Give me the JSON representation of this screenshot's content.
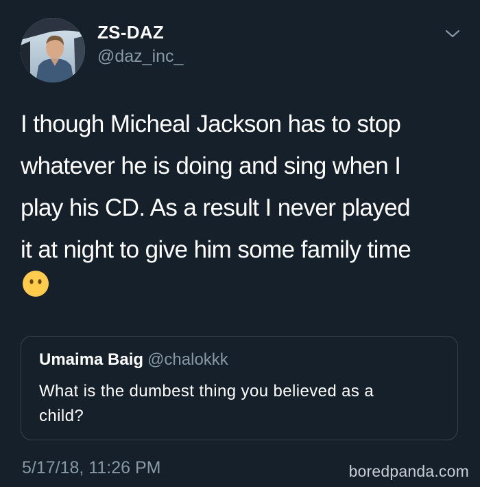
{
  "author": {
    "display_name": "ZS-DAZ",
    "handle": "@daz_inc_"
  },
  "icons": {
    "menu": "chevron-down-icon",
    "emoji": "face-without-mouth-emoji"
  },
  "tweet": {
    "text_lines": [
      "I though Micheal Jackson has to stop",
      "whatever he is doing and sing when I",
      "play his CD. As a result I never played",
      "it at night to give him some family time"
    ],
    "timestamp": "5/17/18, 11:26 PM"
  },
  "quoted_tweet": {
    "display_name": "Umaima Baig",
    "handle": "@chalokkk",
    "text_lines": [
      "What is the dumbest thing you believed as a",
      "child?"
    ]
  },
  "watermark": "boredpanda.com",
  "colors": {
    "background": "#15202b",
    "secondary_text": "#8899a6",
    "border": "#38444d"
  }
}
